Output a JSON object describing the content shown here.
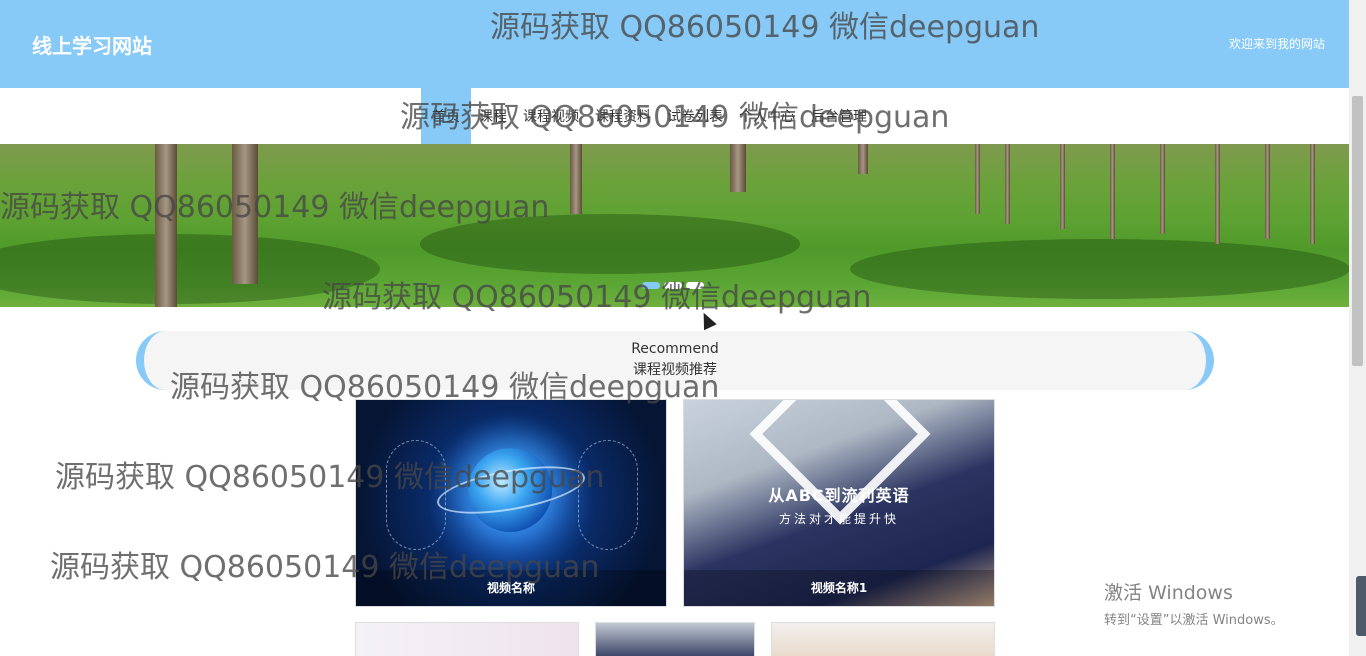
{
  "header": {
    "site_title": "线上学习网站",
    "welcome": "欢迎来到我的网站"
  },
  "nav": {
    "items": [
      {
        "label": "首页",
        "active": true
      },
      {
        "label": "课程"
      },
      {
        "label": "课程视频"
      },
      {
        "label": "课程资料"
      },
      {
        "label": "试卷列表"
      },
      {
        "label": "个人中心"
      },
      {
        "label": "后台管理"
      }
    ]
  },
  "carousel": {
    "slides": 3,
    "active_index": 0
  },
  "recommend": {
    "title_en": "Recommend",
    "title_cn": "课程视频推荐"
  },
  "videos": [
    {
      "name": "视频名称"
    },
    {
      "name": "视频名称1",
      "image_text": "从ABC到流利英语",
      "image_subtext": "方法对才能提升快"
    }
  ],
  "watermark": "源码获取 QQ86050149 微信deepguan",
  "windows_activation": {
    "title": "激活 Windows",
    "subtitle": "转到“设置”以激活 Windows。"
  },
  "colors": {
    "accent": "#87c9f7",
    "header_bg": "#87c9f7"
  }
}
